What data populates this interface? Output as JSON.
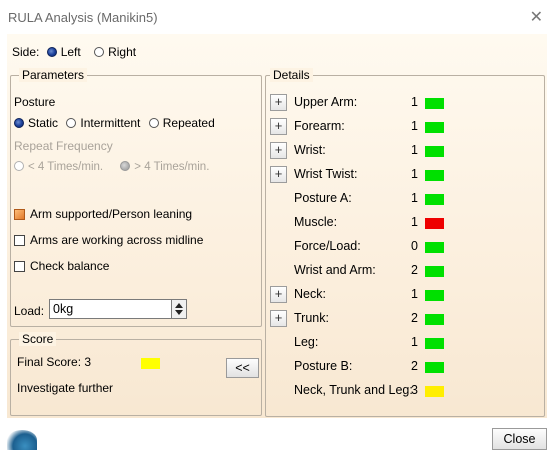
{
  "window": {
    "title": "RULA Analysis (Manikin5)"
  },
  "side": {
    "label": "Side:",
    "options": [
      "Left",
      "Right"
    ],
    "selected": "Left"
  },
  "parameters": {
    "legend": "Parameters",
    "posture_label": "Posture",
    "posture_options": [
      "Static",
      "Intermittent",
      "Repeated"
    ],
    "posture_selected": "Static",
    "repeat_label": "Repeat Frequency",
    "repeat_options": [
      "< 4 Times/min.",
      "> 4 Times/min."
    ],
    "repeat_selected": "> 4 Times/min.",
    "checks": [
      {
        "label": "Arm supported/Person leaning",
        "checked": true
      },
      {
        "label": "Arms are working across midline",
        "checked": false
      },
      {
        "label": "Check balance",
        "checked": false
      }
    ],
    "load_label": "Load:",
    "load_value": "0kg"
  },
  "score": {
    "legend": "Score",
    "final_label": "Final Score: 3",
    "final_color": "#ffff00",
    "message": "Investigate further",
    "collapse_button": "<<"
  },
  "details": {
    "legend": "Details",
    "rows": [
      {
        "label": "Upper Arm:",
        "value": "1",
        "color": "#00e000",
        "expandable": true
      },
      {
        "label": "Forearm:",
        "value": "1",
        "color": "#00e000",
        "expandable": true
      },
      {
        "label": "Wrist:",
        "value": "1",
        "color": "#00e000",
        "expandable": true
      },
      {
        "label": "Wrist Twist:",
        "value": "1",
        "color": "#00e000",
        "expandable": true
      },
      {
        "label": "Posture A:",
        "value": "1",
        "color": "#00e000",
        "expandable": false
      },
      {
        "label": "Muscle:",
        "value": "1",
        "color": "#ee0000",
        "expandable": false
      },
      {
        "label": "Force/Load:",
        "value": "0",
        "color": "#00e000",
        "expandable": false
      },
      {
        "label": "Wrist and Arm:",
        "value": "2",
        "color": "#00e000",
        "expandable": false
      },
      {
        "label": "Neck:",
        "value": "1",
        "color": "#00e000",
        "expandable": true
      },
      {
        "label": "Trunk:",
        "value": "2",
        "color": "#00e000",
        "expandable": true
      },
      {
        "label": "Leg:",
        "value": "1",
        "color": "#00e000",
        "expandable": false
      },
      {
        "label": "Posture B:",
        "value": "2",
        "color": "#00e000",
        "expandable": false
      },
      {
        "label": "Neck, Trunk and Leg:",
        "value": "3",
        "color": "#ffee00",
        "expandable": false
      }
    ],
    "expand_symbol": "+"
  },
  "footer": {
    "close_label": "Close"
  }
}
